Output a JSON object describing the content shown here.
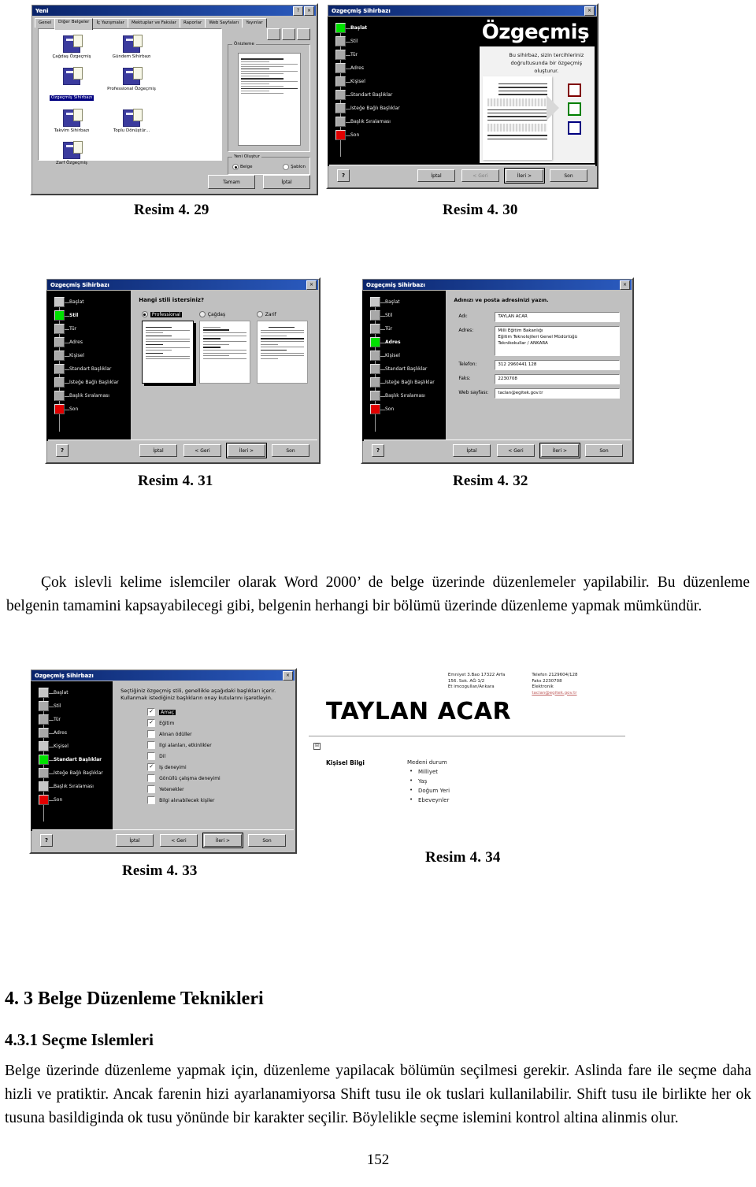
{
  "page": {
    "number": "152",
    "language": "tr"
  },
  "figures": [
    {
      "id": "fig-29",
      "caption": "Resim 4. 29"
    },
    {
      "id": "fig-30",
      "caption": "Resim 4. 30"
    },
    {
      "id": "fig-31",
      "caption": "Resim 4. 31"
    },
    {
      "id": "fig-32",
      "caption": "Resim 4. 32"
    },
    {
      "id": "fig-33",
      "caption": "Resim 4. 33"
    },
    {
      "id": "fig-34",
      "caption": "Resim 4. 34"
    }
  ],
  "dialog_new": {
    "title": "Yeni",
    "tabs": [
      {
        "label": "Genel",
        "active": false
      },
      {
        "label": "Diğer Belgeler",
        "active": true
      },
      {
        "label": "İç Yazışmalar",
        "active": false
      },
      {
        "label": "Mektuplar ve Fakslar",
        "active": false
      },
      {
        "label": "Raporlar",
        "active": false
      },
      {
        "label": "Web Sayfaları",
        "active": false
      },
      {
        "label": "Yayınlar",
        "active": false
      }
    ],
    "templates": [
      {
        "name": "Çağdaş Özgeçmiş",
        "selected": false
      },
      {
        "name": "Gündem Sihirbazı",
        "selected": false
      },
      {
        "name": "Özgeçmiş Sihirbazı",
        "selected": true
      },
      {
        "name": "Professional Özgeçmiş",
        "selected": false
      },
      {
        "name": "Takvim Sihirbazı",
        "selected": false
      },
      {
        "name": "Toplu Dönüştür...",
        "selected": false
      },
      {
        "name": "Zarf Özgeçmiş",
        "selected": false
      }
    ],
    "preview_group": "Önizleme",
    "create_group": "Yeni Oluştur",
    "create_options": [
      {
        "label": "Belge",
        "selected": true
      },
      {
        "label": "Şablon",
        "selected": false
      }
    ],
    "buttons": {
      "ok": "Tamam",
      "cancel": "İptal"
    },
    "close_btn": "×",
    "help_btn": "?"
  },
  "wizard": {
    "title": "Özgeçmiş Sihirbazı",
    "close_btn": "×",
    "steps": [
      "Başlat",
      "Stil",
      "Tür",
      "Adres",
      "Kişisel",
      "Standart Başlıklar",
      "İsteğe Bağlı Başlıklar",
      "Başlık Sıralaması",
      "Son"
    ],
    "buttons": {
      "help": "?",
      "cancel": "İptal",
      "back": "< Geri",
      "next": "İleri >",
      "finish": "Son"
    }
  },
  "wizard_start": {
    "active_step": "Başlat",
    "banner_title": "Özgeçmiş Sihirbazı",
    "description": "Bu sihirbaz, sizin tercihleriniz doğrultusunda bir özgeçmiş oluşturur.",
    "swatch_colors": [
      "#800000",
      "#008000",
      "#000080"
    ]
  },
  "wizard_style": {
    "active_step": "Stil",
    "question": "Hangi stili istersiniz?",
    "options": [
      {
        "label": "Professional",
        "selected": true
      },
      {
        "label": "Çağdaş",
        "selected": false
      },
      {
        "label": "Zarif",
        "selected": false
      }
    ]
  },
  "wizard_address": {
    "active_step": "Adres",
    "question": "Adınızı ve posta adresinizi yazın.",
    "fields": [
      {
        "label": "Adı:",
        "value": "TAYLAN ACAR"
      },
      {
        "label": "Adres:",
        "value": "Milli Eğitim Bakanlığı\nEğitim Teknolojileri Genel Müdürlüğü\nTeknikokullar / ANKARA"
      },
      {
        "label": "Telefon:",
        "value": "312 2960441 128"
      },
      {
        "label": "Faks:",
        "value": "2230708"
      },
      {
        "label": "Web sayfası:",
        "value": "taclan@egitek.gov.tr"
      }
    ]
  },
  "wizard_headings": {
    "active_step": "Standart Başlıklar",
    "instruction": "Seçtiğiniz özgeçmiş stili, genellikle aşağıdaki başlıkları içerir. Kullanmak istediğiniz başlıkların onay kutularını işaretleyin.",
    "items": [
      {
        "label": "Amaç",
        "checked": true
      },
      {
        "label": "Eğitim",
        "checked": true
      },
      {
        "label": "Alınan ödüller",
        "checked": false
      },
      {
        "label": "İlgi alanları, etkinlikler",
        "checked": false
      },
      {
        "label": "Dil",
        "checked": false
      },
      {
        "label": "İş deneyimi",
        "checked": true
      },
      {
        "label": "Gönüllü çalışma deneyimi",
        "checked": false
      },
      {
        "label": "Yetenekler",
        "checked": false
      },
      {
        "label": "Bilgi alınabilecek kişiler",
        "checked": false
      }
    ]
  },
  "doc_preview": {
    "name": "TAYLAN ACAR",
    "contact_left": "Emniyet 3.Bao 17322 Arfa\n156. Sok. AĞ-1/2\nEt imcogullan/Ankara",
    "contact_right": "Telefon 2129604/128\nFaks 2230708\nElektronik",
    "email": "taclan@egitek.gov.tr",
    "section_label": "Kişisel Bilgi",
    "items_header": "Medeni durum",
    "items": [
      "Milliyet",
      "Yaş",
      "Doğum Yeri",
      "Ebeveynler"
    ]
  },
  "content": {
    "paragraph_1": "Çok islevli kelime islemciler olarak Word 2000’ de belge üzerinde düzenlemeler yapilabilir. Bu düzenleme belgenin tamamini kapsayabilecegi gibi, belgenin herhangi bir bölümü üzerinde düzenleme yapmak mümkündür.",
    "heading_43": "4. 3 Belge Düzenleme Teknikleri",
    "heading_431": "4.3.1 Seçme Islemleri",
    "paragraph_2": "Belge üzerinde düzenleme yapmak için, düzenleme yapilacak bölümün seçilmesi gerekir. Aslinda fare ile seçme daha hizli ve pratiktir. Ancak farenin hizi ayarlanamiyorsa Shift tusu ile ok tuslari kullanilabilir. Shift tusu ile birlikte her ok tusuna basildiginda ok tusu yönünde bir karakter seçilir. Böylelikle seçme islemini kontrol altina alinmis olur."
  }
}
